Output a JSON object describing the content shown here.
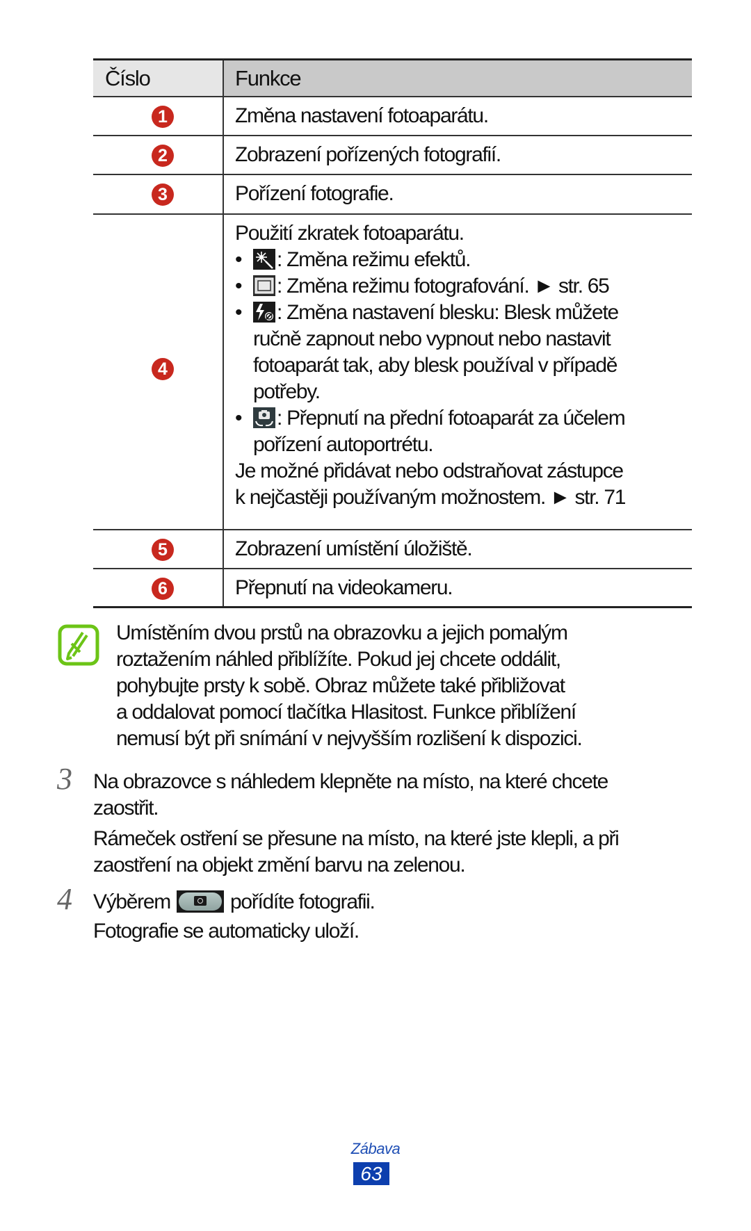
{
  "table": {
    "headers": {
      "number": "Číslo",
      "function": "Funkce"
    },
    "rows": [
      {
        "badge": "1",
        "text": "Změna nastavení fotoaparátu."
      },
      {
        "badge": "2",
        "text": "Zobrazení pořízených fotografií."
      },
      {
        "badge": "3",
        "text": "Pořízení fotografie."
      },
      {
        "badge": "4",
        "intro": "Použití zkratek fotoaparátu.",
        "shortcuts": [
          {
            "icon": "effects-icon",
            "lines": [
              ": Změna režimu efektů."
            ]
          },
          {
            "icon": "shooting-mode-icon",
            "lines": [
              ": Změna režimu fotografování. ► str. 65"
            ]
          },
          {
            "icon": "flash-off-icon",
            "lines": [
              ": Změna nastavení blesku: Blesk můžete",
              "ručně zapnout nebo vypnout nebo nastavit",
              "fotoaparát tak, aby blesk používal v případě",
              "potřeby."
            ]
          },
          {
            "icon": "switch-camera-icon",
            "lines": [
              ": Přepnutí na přední fotoaparát za účelem",
              "pořízení autoportrétu."
            ]
          }
        ],
        "outro": [
          "Je možné přidávat nebo odstraňovat zástupce",
          "k nejčastěji používaným možnostem. ► str. 71"
        ]
      },
      {
        "badge": "5",
        "text": "Zobrazení umístění úložiště."
      },
      {
        "badge": "6",
        "text": "Přepnutí na videokameru."
      }
    ]
  },
  "note": {
    "icon": "note-pencil-icon",
    "lines": [
      "Umístěním dvou prstů na obrazovku a jejich pomalým",
      "roztažením náhled přiblížíte. Pokud jej chcete oddálit,",
      "pohybujte prsty k sobě. Obraz můžete také přibližovat",
      "a oddalovat pomocí tlačítka Hlasitost. Funkce přiblížení",
      "nemusí být při snímání v nejvyšším rozlišení k dispozici."
    ]
  },
  "steps": [
    {
      "number": "3",
      "lines": [
        "Na obrazovce s náhledem klepněte na místo, na které chcete",
        "zaostřit."
      ],
      "detail": [
        "Rámeček ostření se přesune na místo, na které jste klepli, a při",
        "zaostření na objekt změní barvu na zelenou."
      ]
    },
    {
      "number": "4",
      "before_icon": "Výběrem",
      "icon": "shutter-button-icon",
      "after_icon": "pořídíte fotografii.",
      "detail": [
        "Fotografie se automaticky uloží."
      ]
    }
  ],
  "footer": {
    "section": "Zábava",
    "page": "63"
  },
  "colors": {
    "badge": "#c8281e",
    "note_green": "#6cc417",
    "footer_blue": "#0d3fae"
  }
}
